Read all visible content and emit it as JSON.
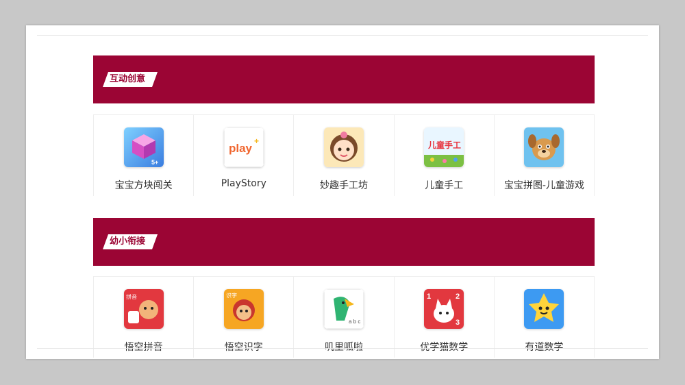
{
  "sections": [
    {
      "title": "互动创意",
      "apps": [
        {
          "name": "宝宝方块闯关",
          "icon": "cube-app-icon"
        },
        {
          "name": "PlayStory",
          "icon": "playstory-app-icon"
        },
        {
          "name": "妙趣手工坊",
          "icon": "girl-app-icon"
        },
        {
          "name": "儿童手工",
          "icon": "kids-craft-app-icon"
        },
        {
          "name": "宝宝拼图-儿童游戏",
          "icon": "puzzle-dog-app-icon"
        }
      ]
    },
    {
      "title": "幼小衔接",
      "apps": [
        {
          "name": "悟空拼音",
          "icon": "wukong-pinyin-app-icon"
        },
        {
          "name": "悟空识字",
          "icon": "wukong-characters-app-icon"
        },
        {
          "name": "叽里呱啦",
          "icon": "parrot-app-icon"
        },
        {
          "name": "优学猫数学",
          "icon": "cat-math-app-icon"
        },
        {
          "name": "有道数学",
          "icon": "youdao-math-app-icon"
        }
      ]
    }
  ],
  "icon_text": {
    "play": "play",
    "plus": "+",
    "kids_craft": "儿童手工",
    "badge_5": "5+",
    "pinyin_tag": "拼音",
    "literacy_tag": "识字",
    "math_1": "1",
    "math_2": "2",
    "math_3": "3",
    "abc": "a b c"
  },
  "colors": {
    "header_bg": "#9b0534",
    "page_bg": "#ffffff",
    "backdrop": "#c8c8c8"
  }
}
